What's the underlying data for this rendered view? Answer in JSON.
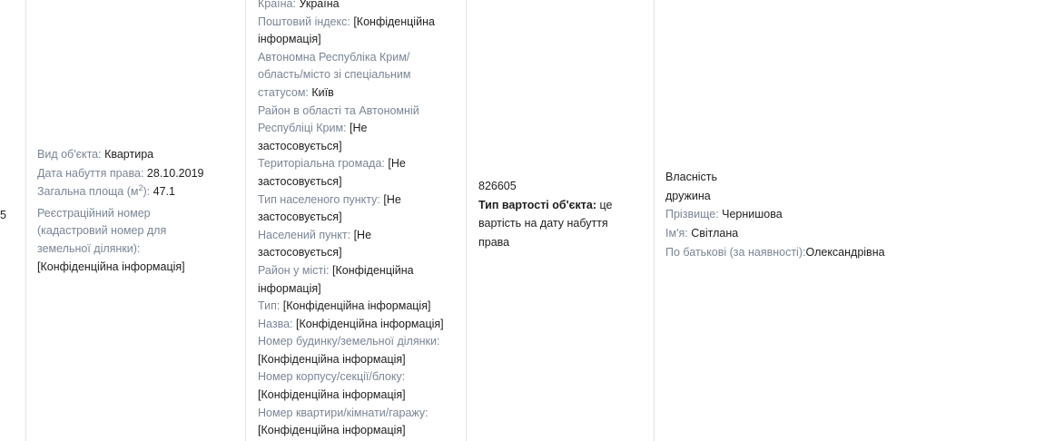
{
  "row": {
    "index": "5",
    "object": {
      "type_label": "Вид об'єкта:",
      "type_value": "Квартира",
      "acq_date_label": "Дата набуття права:",
      "acq_date_value": "28.10.2019",
      "area_label_prefix": "Загальна площа (м",
      "area_label_sup": "2",
      "area_label_suffix": "):",
      "area_value": "47.1",
      "reg_number_label": "Реєстраційний номер (кадастровий номер для земельної ділянки):",
      "reg_number_value": "[Конфіденційна інформація]"
    },
    "address": {
      "country_label": "Країна:",
      "country_value": "Україна",
      "postal_label": "Поштовий індекс:",
      "postal_value": "[Конфіденційна інформація]",
      "region_label": "Автономна Республіка Крим/ область/місто зі спеціальним статусом:",
      "region_value": "Київ",
      "district_label": "Район в області та Автономній Республіці Крим:",
      "district_value": "[Не застосовується]",
      "community_label": "Територіальна громада:",
      "community_value": "[Не застосовується]",
      "settlement_type_label": "Тип населеного пункту:",
      "settlement_type_value": "[Не застосовується]",
      "settlement_label": "Населений пункт:",
      "settlement_value": "[Не застосовується]",
      "city_district_label": "Район у місті:",
      "city_district_value": "[Конфіденційна інформація]",
      "street_type_label": "Тип:",
      "street_type_value": "[Конфіденційна інформація]",
      "street_name_label": "Назва:",
      "street_name_value": "[Конфіденційна інформація]",
      "house_label": "Номер будинку/земельної ділянки:",
      "house_value": "[Конфіденційна інформація]",
      "building_label": "Номер корпусу/секції/блоку:",
      "building_value": "[Конфіденційна інформація]",
      "apartment_label": "Номер квартири/кімнати/гаражу:",
      "apartment_value": "[Конфіденційна інформація]"
    },
    "cost": {
      "value": "826605",
      "type_label": "Тип вартості об'єкта:",
      "type_value": "це вартість на дату набуття права"
    },
    "ownership": {
      "right_type": "Власність",
      "owner_relation": "дружина",
      "surname_label": "Прізвище:",
      "surname_value": "Чернишова",
      "name_label": "Ім'я:",
      "name_value": "Світлана",
      "patronymic_label": "По батькові (за наявності):",
      "patronymic_value": "Олександрівна"
    }
  }
}
